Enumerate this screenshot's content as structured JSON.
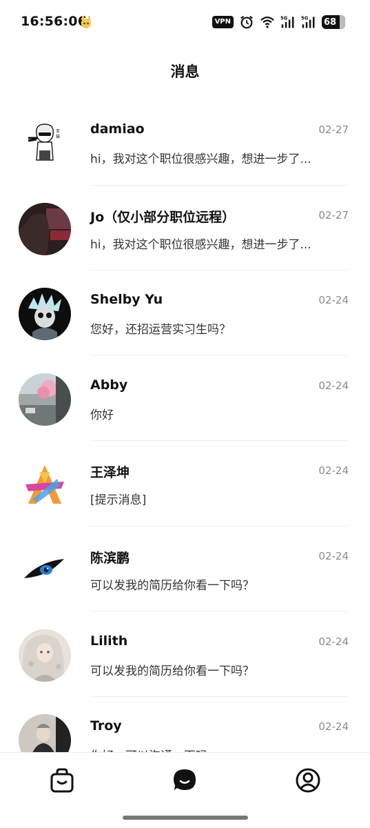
{
  "status_bar": {
    "time": "16:56:06",
    "vpn_label": "VPN",
    "signal_1_label": "5G",
    "signal_2_label": "5G",
    "battery": "68",
    "battery_level": 0.68
  },
  "header": {
    "title": "消息"
  },
  "conversations": [
    {
      "name": "damiao",
      "date": "02-27",
      "preview": "hi，我对这个职位很感兴趣，想进一步了..."
    },
    {
      "name": "Jo（仅小部分职位远程）",
      "date": "02-27",
      "preview": "hi，我对这个职位很感兴趣，想进一步了..."
    },
    {
      "name": "Shelby Yu",
      "date": "02-24",
      "preview": "您好，还招运营实习生吗？"
    },
    {
      "name": "Abby",
      "date": "02-24",
      "preview": "你好"
    },
    {
      "name": "王泽坤",
      "date": "02-24",
      "preview": "[提示消息]"
    },
    {
      "name": "陈滨鹏",
      "date": "02-24",
      "preview": "可以发我的简历给你看一下吗？"
    },
    {
      "name": "Lilith",
      "date": "02-24",
      "preview": "可以发我的简历给你看一下吗？"
    },
    {
      "name": "Troy",
      "date": "02-24",
      "preview": "你好，可以沟通一下吗"
    }
  ],
  "bottom_nav": {
    "items": [
      {
        "icon": "bag-icon",
        "active": false
      },
      {
        "icon": "chat-bubble-icon",
        "active": true
      },
      {
        "icon": "profile-icon",
        "active": false
      }
    ]
  },
  "colors": {
    "text_primary": "#111111",
    "text_secondary": "#8a8a8a",
    "divider": "#eeeeee",
    "background": "#ffffff"
  }
}
